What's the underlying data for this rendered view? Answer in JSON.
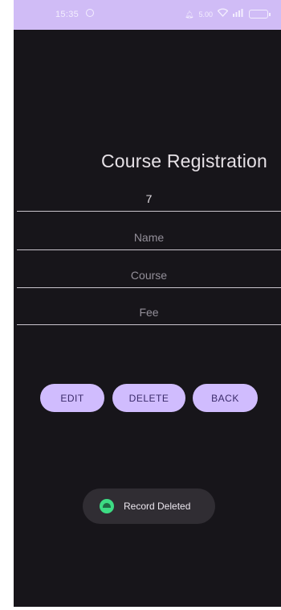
{
  "status_bar": {
    "time": "15:35",
    "icons": [
      "whatsapp-icon",
      "bell-icon",
      "data-speed-icon",
      "wifi-icon",
      "signal-icon",
      "battery-icon"
    ],
    "data_speed": "5.00",
    "battery": "55"
  },
  "screen": {
    "title": "Course Registration"
  },
  "form": {
    "id_value": "7",
    "name_value": "",
    "name_placeholder": "Name",
    "course_value": "",
    "course_placeholder": "Course",
    "fee_value": "",
    "fee_placeholder": "Fee"
  },
  "buttons": {
    "edit": "EDIT",
    "delete": "DELETE",
    "back": "BACK"
  },
  "toast": {
    "message": "Record Deleted"
  },
  "colors": {
    "status_bar_bg": "#d0bcf6",
    "screen_bg": "#17151a",
    "button_bg": "#d0bcfe",
    "toast_bg": "#302d33",
    "toast_icon": "#3ddc84"
  }
}
